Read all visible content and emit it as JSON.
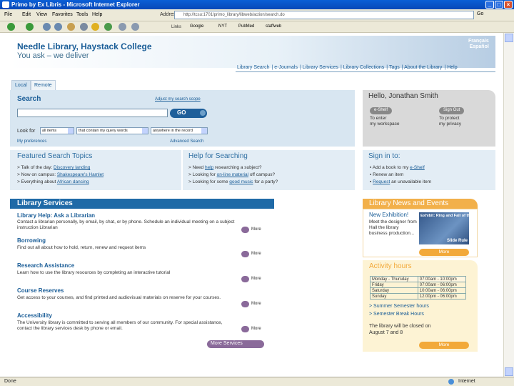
{
  "browser": {
    "title": "Primo by Ex Libris - Microsoft Internet Explorer",
    "menu": [
      "File",
      "Edit",
      "View",
      "Favorites",
      "Tools",
      "Help"
    ],
    "address_label": "Address",
    "address_value": "http://tcsu:1701/primo_library/libweb/action/search.do",
    "go_label": "Go",
    "links_label": "Links",
    "links": [
      "Google",
      "NYT",
      "PubMed",
      "staffweb"
    ],
    "status": "Done",
    "zone": "Internet"
  },
  "header": {
    "library_name": "Needle Library, Haystack College",
    "tagline": "You ask – we deliver",
    "lang_fr": "Français",
    "lang_es": "Español",
    "nav": [
      "Library Search",
      "e-Journals",
      "Library Services",
      "Library Collections",
      "Tags",
      "About the Library",
      "Help"
    ]
  },
  "tabs": [
    "Local",
    "Remote"
  ],
  "search": {
    "title": "Search",
    "adv_link": "Adjust my search scope",
    "input_value": "",
    "go_label": "GO",
    "look_for": "Look for",
    "opt1": "all items",
    "opt2": "that contain my query words",
    "opt3": "anywhere in the record",
    "my_preferences": "My preferences",
    "advanced": "Advanced Search"
  },
  "hello": {
    "greeting": "Hello, Jonathan Smith",
    "eshelf": "e-Shelf",
    "eshelf_text1": "To enter",
    "eshelf_text2": "my workspace",
    "signout": "Sign Out",
    "signout_text1": "To protect",
    "signout_text2": "my privacy"
  },
  "featured": {
    "title": "Featured Search Topics",
    "items": [
      {
        "pre": "> Talk of the day: ",
        "link": "Discovery landing"
      },
      {
        "pre": "> Now on campus: ",
        "link": "Shakespeare's Hamlet"
      },
      {
        "pre": "> Everything about ",
        "link": "African dancing"
      }
    ]
  },
  "help": {
    "title": "Help for Searching",
    "items": [
      {
        "pre": "> Need ",
        "link": "help",
        "post": " researching a subject?"
      },
      {
        "pre": "> Looking for ",
        "link": "on-line material",
        "post": " off campus?"
      },
      {
        "pre": "> Looking for some ",
        "link": "good music",
        "post": " for a party?"
      }
    ]
  },
  "signin": {
    "title": "Sign in to:",
    "items": [
      {
        "pre": "▪ Add a book to my ",
        "link": "e-Shelf",
        "post": ""
      },
      {
        "pre": "▪ Renew an item",
        "link": "",
        "post": ""
      },
      {
        "pre": "▪ ",
        "link": "Request",
        "post": " an unavailable item"
      }
    ]
  },
  "services": {
    "title": "Library Services",
    "more": "More",
    "more_services": "More Services",
    "items": [
      {
        "title": "Library Help: Ask a Librarian",
        "desc": "Contact a librarian personally, by email, by chat, or by phone. Schedule an individual meeting on a subject instruction Librarian"
      },
      {
        "title": "Borrowing",
        "desc": "Find out all about how to hold, return, renew and request items"
      },
      {
        "title": "Research Assistance",
        "desc": "Learn how to use the library resources by completing an interactive tutorial"
      },
      {
        "title": "Course Reserves",
        "desc": "Get access to your courses, and find printed and audiovisual materials on reserve for your courses."
      },
      {
        "title": "Accessibility",
        "desc": "The University library is committed to serving all members of our community. For special assistance, contact the library services desk by phone or email."
      }
    ]
  },
  "news": {
    "title": "Library News and Events",
    "headline": "New Exhibition!",
    "text": "Meet the designer from Hall the library business production...",
    "image_title": "Exhibit: Ring and Fall of the ...",
    "image_caption": "Slide Rule",
    "more": "More"
  },
  "activity": {
    "title": "Activity hours",
    "hours": [
      [
        "Monday - Thursday",
        "07:00am - 10:00pm"
      ],
      [
        "Friday",
        "07:00am - 06:00pm"
      ],
      [
        "Saturday",
        "10:00am - 06:00pm"
      ],
      [
        "Sunday",
        "12:00pm - 06:00pm"
      ]
    ],
    "link1": "> Summer Semester hours",
    "link2": "> Semester Break Hours",
    "note": "The library will be closed on August 7 and 8",
    "more": "More"
  },
  "colors": {
    "brand": "#1a5d97",
    "services_bar": "#1f6aa7",
    "news_accent": "#f2b04a",
    "more_button": "#8a6a9a"
  }
}
